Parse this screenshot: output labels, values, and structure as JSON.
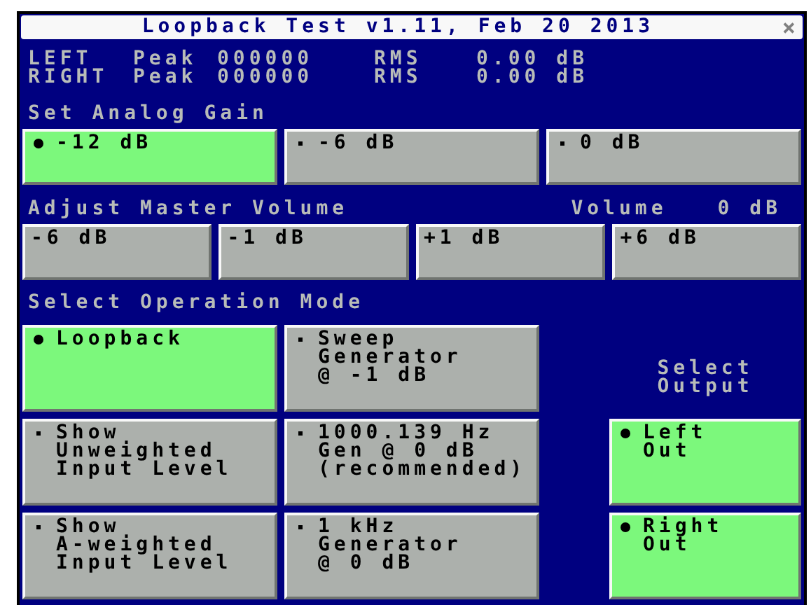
{
  "window": {
    "title": "Loopback Test v1.11, Feb 20 2013",
    "close": "×"
  },
  "meters": [
    {
      "channel": "LEFT",
      "peak_label": "Peak",
      "peak": "000000",
      "rms_label": "RMS",
      "rms": "0.00 dB"
    },
    {
      "channel": "RIGHT",
      "peak_label": "Peak",
      "peak": "000000",
      "rms_label": "RMS",
      "rms": "0.00 dB"
    }
  ],
  "analog_gain": {
    "heading": "Set Analog Gain",
    "options": [
      {
        "label": "-12 dB",
        "selected": true
      },
      {
        "label": "-6 dB",
        "selected": false
      },
      {
        "label": "0 dB",
        "selected": false
      }
    ]
  },
  "master_volume": {
    "heading": "Adjust Master Volume",
    "volume_label": "Volume",
    "volume": "0 dB",
    "buttons": [
      "-6 dB",
      "-1 dB",
      "+1 dB",
      "+6 dB"
    ]
  },
  "operation_mode": {
    "heading": "Select Operation Mode",
    "options": [
      {
        "label": "Loopback",
        "selected": true
      },
      {
        "label": "Sweep\nGenerator\n@ -1 dB",
        "selected": false
      },
      {
        "label": "Show\nUnweighted\nInput Level",
        "selected": false
      },
      {
        "label": "1000.139 Hz\nGen @ 0 dB\n(recommended)",
        "selected": false
      },
      {
        "label": "Show\nA-weighted\nInput Level",
        "selected": false
      },
      {
        "label": "1 kHz\nGenerator\n@ 0 dB",
        "selected": false
      }
    ]
  },
  "output": {
    "heading": "Select Output",
    "options": [
      {
        "label": "Left\nOut",
        "selected": true
      },
      {
        "label": "Right\nOut",
        "selected": true
      }
    ]
  }
}
